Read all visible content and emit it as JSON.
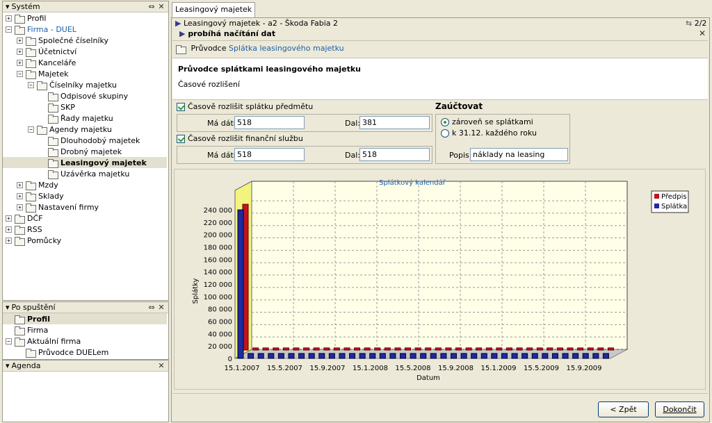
{
  "left": {
    "system_title": "Systém",
    "tree": [
      {
        "label": "Profil",
        "level": 0,
        "exp": "+",
        "color": "#000"
      },
      {
        "label": "Firma - DUEL",
        "level": 0,
        "exp": "−",
        "color": "#1f5fa8"
      },
      {
        "label": "Společné číselníky",
        "level": 1,
        "exp": "+"
      },
      {
        "label": "Účetnictví",
        "level": 1,
        "exp": "+"
      },
      {
        "label": "Kanceláře",
        "level": 1,
        "exp": "+"
      },
      {
        "label": "Majetek",
        "level": 1,
        "exp": "−"
      },
      {
        "label": "Číselníky majetku",
        "level": 2,
        "exp": "−"
      },
      {
        "label": "Odpisové skupiny",
        "level": 3,
        "exp": ""
      },
      {
        "label": "SKP",
        "level": 3,
        "exp": ""
      },
      {
        "label": "Řady majetku",
        "level": 3,
        "exp": ""
      },
      {
        "label": "Agendy majetku",
        "level": 2,
        "exp": "−"
      },
      {
        "label": "Dlouhodobý majetek",
        "level": 3,
        "exp": ""
      },
      {
        "label": "Drobný majetek",
        "level": 3,
        "exp": ""
      },
      {
        "label": "Leasingový majetek",
        "level": 3,
        "exp": "",
        "selected": true
      },
      {
        "label": "Uzávěrka majetku",
        "level": 3,
        "exp": ""
      },
      {
        "label": "Mzdy",
        "level": 1,
        "exp": "+"
      },
      {
        "label": "Sklady",
        "level": 1,
        "exp": "+"
      },
      {
        "label": "Nastavení firmy",
        "level": 1,
        "exp": "+"
      },
      {
        "label": "DČF",
        "level": 0,
        "exp": "+"
      },
      {
        "label": "RSS",
        "level": 0,
        "exp": "+"
      },
      {
        "label": "Pomůcky",
        "level": 0,
        "exp": "+"
      }
    ],
    "startup_title": "Po spuštění",
    "startup": [
      {
        "label": "Profil",
        "level": 0,
        "exp": "",
        "selected": true
      },
      {
        "label": "Firma",
        "level": 0,
        "exp": ""
      },
      {
        "label": "Aktuální firma",
        "level": 0,
        "exp": "−"
      },
      {
        "label": "Průvodce DUELem",
        "level": 1,
        "exp": ""
      }
    ],
    "agenda_title": "Agenda"
  },
  "main": {
    "tab": "Leasingový majetek",
    "crumb1": "Leasingový majetek - a2 - Škoda Fabia 2",
    "crumb2": "probíhá načítání dat",
    "pager": "2/2",
    "wizard_prefix": "Průvodce",
    "wizard_link": "Splátka leasingového majetku",
    "heading": "Průvodce splátkami leasingového majetku",
    "subheading": "Časové rozlišení",
    "cb1_label": "Časově rozlišit splátku předmětu",
    "cb2_label": "Časově rozlišit finanční službu",
    "ma_dati_label": "Má dáti:",
    "dal_label": "Dal:",
    "row1_ma_dati": "518",
    "row1_dal": "381",
    "row2_ma_dati": "518",
    "row2_dal": "518",
    "zauctovat_title": "Zaúčtovat",
    "radio1": "zároveň se splátkami",
    "radio2": "k 31.12. každého roku",
    "popis_label": "Popis:",
    "popis_value": "náklady na leasing",
    "btn_back": "< Zpět",
    "btn_finish": "Dokončit"
  },
  "chart_data": {
    "type": "bar",
    "title": "Splátkový kalendář",
    "xlabel": "Datum",
    "ylabel": "Splátky",
    "ylim": [
      0,
      240000
    ],
    "yticks": [
      "0",
      "20 000",
      "40 000",
      "60 000",
      "80 000",
      "100 000",
      "120 000",
      "140 000",
      "160 000",
      "180 000",
      "200 000",
      "220 000",
      "240 000"
    ],
    "xticks": [
      "15.1.2007",
      "15.5.2007",
      "15.9.2007",
      "15.1.2008",
      "15.5.2008",
      "15.9.2008",
      "15.1.2009",
      "15.5.2009",
      "15.9.2009"
    ],
    "legend": [
      "Předpis",
      "Splátka"
    ],
    "legend_colors": [
      "#c0141e",
      "#1e2a9e"
    ],
    "first_value": 240000,
    "other_value": 8000,
    "count": 37
  }
}
